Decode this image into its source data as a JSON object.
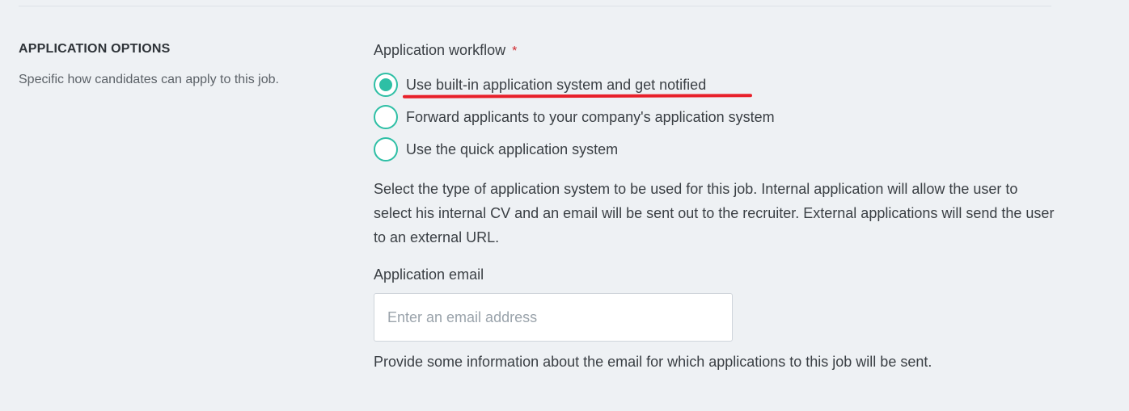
{
  "section": {
    "title": "APPLICATION OPTIONS",
    "description": "Specific how candidates can apply to this job."
  },
  "workflow": {
    "label": "Application workflow",
    "required_mark": "*",
    "options": [
      {
        "label": "Use built-in application system and get notified",
        "selected": true
      },
      {
        "label": "Forward applicants to your company's application system",
        "selected": false
      },
      {
        "label": "Use the quick application system",
        "selected": false
      }
    ],
    "help": "Select the type of application system to be used for this job. Internal application will allow the user to select his internal CV and an email will be sent out to the recruiter. External applications will send the user to an external URL."
  },
  "email": {
    "label": "Application email",
    "placeholder": "Enter an email address",
    "value": "",
    "help": "Provide some information about the email for which applications to this job will be sent."
  },
  "colors": {
    "accent": "#2ebfa5",
    "required": "#d0282e",
    "annotation": "#e8202a",
    "background": "#eef1f4"
  }
}
